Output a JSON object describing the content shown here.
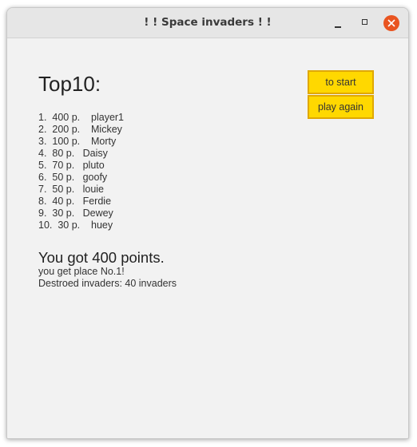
{
  "window": {
    "title": "! ! Space invaders ! !"
  },
  "titlebar_buttons": {
    "minimize_icon": "minimize-icon",
    "maximize_icon": "maximize-icon",
    "close_icon": "close-icon",
    "close_color": "#e95420"
  },
  "heading": "Top10:",
  "scores": [
    {
      "text": "1.  400 p.    player1"
    },
    {
      "text": "2.  200 p.    Mickey"
    },
    {
      "text": "3.  100 p.    Morty"
    },
    {
      "text": "4.  80 p.   Daisy"
    },
    {
      "text": "5.  70 p.   pluto"
    },
    {
      "text": "6.  50 p.   goofy"
    },
    {
      "text": "7.  50 p.   louie"
    },
    {
      "text": "8.  40 p.   Ferdie"
    },
    {
      "text": "9.  30 p.   Dewey"
    },
    {
      "text": "10.  30 p.    huey"
    }
  ],
  "result": {
    "title": "You got 400 points.",
    "place": "you get place No.1!",
    "destroyed": "Destroed invaders: 40 invaders"
  },
  "buttons": {
    "start_label": "to start",
    "again_label": "play again",
    "color": "#ffd800",
    "border_color": "#e0a800"
  }
}
